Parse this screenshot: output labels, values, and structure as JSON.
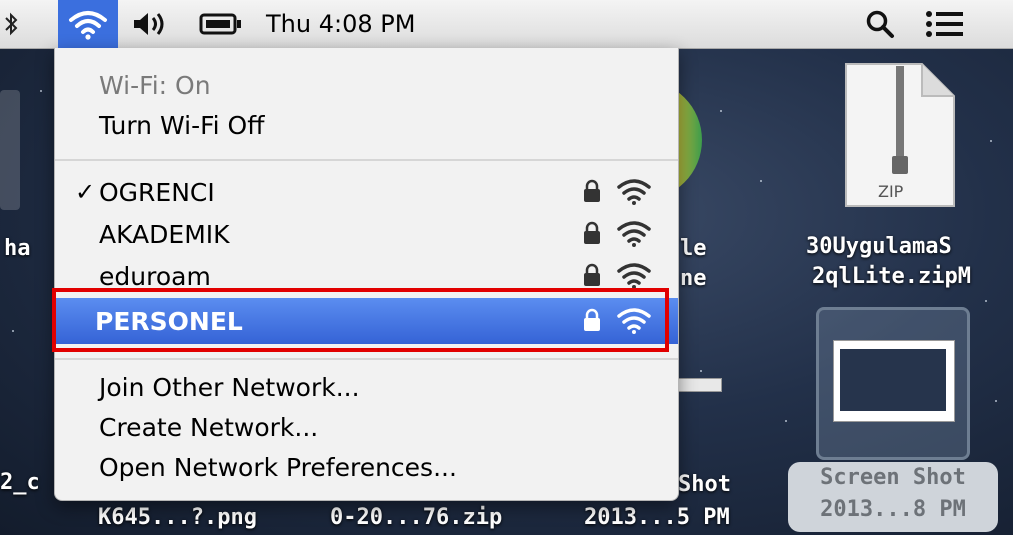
{
  "menubar": {
    "clock": "Thu 4:08 PM",
    "icons": [
      "bluetooth-icon",
      "wifi-icon",
      "volume-icon",
      "battery-icon",
      "search-icon",
      "list-icon"
    ]
  },
  "wifi_menu": {
    "status": "Wi-Fi: On",
    "toggle": "Turn Wi-Fi Off",
    "networks": [
      {
        "name": "OGRENCI",
        "connected": true,
        "locked": true
      },
      {
        "name": "AKADEMIK",
        "connected": false,
        "locked": true
      },
      {
        "name": "eduroam",
        "connected": false,
        "locked": true
      },
      {
        "name": "PERSONEL",
        "connected": false,
        "locked": true,
        "highlighted": true
      }
    ],
    "join_other": "Join Other Network...",
    "create": "Create Network...",
    "open_prefs": "Open Network Preferences..."
  },
  "desktop": {
    "left_label_1": "ha",
    "left_label_2": "2_c",
    "bottom_label_1": "K645...?.png",
    "bottom_label_2": "0-20...76.zip",
    "mid_label_1": "le",
    "mid_label_2": "ne",
    "shot_label_1": "Shot",
    "shot_label_2": "2013...5 PM",
    "zip_badge": "ZIP",
    "zip_label_1": "30UygulamaS",
    "zip_label_2": "2qlLite.zipM",
    "selected_label_1": "Screen Shot",
    "selected_label_2": "2013...8 PM"
  },
  "colors": {
    "highlight": "#3563d6",
    "callout": "#e10000"
  }
}
